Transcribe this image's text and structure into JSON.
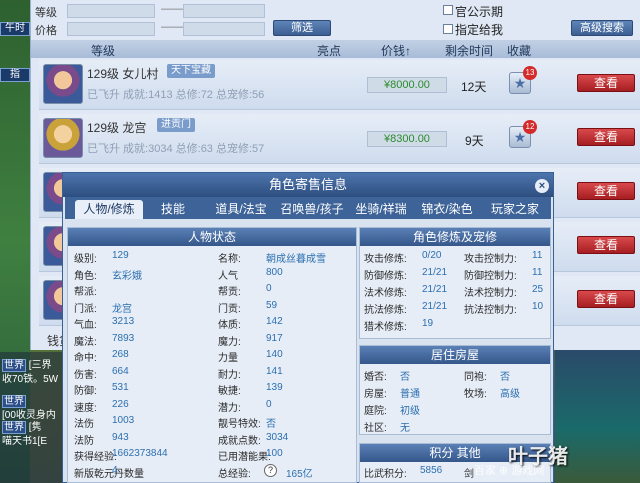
{
  "filters": {
    "row1_label": "等级",
    "row2_label": "价格",
    "dash": "——",
    "filter_button": "筛选",
    "public_period_label": "官公示期",
    "designated_label": "指定给我",
    "advanced_search": "高级搜索"
  },
  "columns": {
    "level": "等级",
    "highlight": "亮点",
    "price": "价钱↑",
    "remaining": "剩余时间",
    "favorite": "收藏"
  },
  "listings": [
    {
      "level": "129级",
      "school": "女儿村",
      "badge": "天下宝藏",
      "sub": "已飞升  成就:1413 总修:72 总宠修:56",
      "price": "¥8000.00",
      "remaining": "12天",
      "fav_count": "13",
      "view": "查看"
    },
    {
      "level": "129级",
      "school": "龙宫",
      "badge": "进贡门",
      "sub": "已飞升  成就:3034 总修:63 总宠修:57",
      "price": "¥8300.00",
      "remaining": "9天",
      "fav_count": "12",
      "view": "查看"
    },
    {
      "view": "查看"
    },
    {
      "view": "查看"
    },
    {
      "view": "查看"
    }
  ],
  "footer_label": "钱货",
  "chat": {
    "l1": "世界",
    "l1b": "[三界",
    "l2": "收70铁。5W",
    "l3": "世界",
    "l4": "[00收灵身内",
    "l5": "世界",
    "l5b": "[隽",
    "l6": "喵天书1[E"
  },
  "dialog": {
    "title": "角色寄售信息",
    "close": "×",
    "tabs": [
      "人物/修炼",
      "技能",
      "道具/法宝",
      "召唤兽/孩子",
      "坐骑/祥瑞",
      "锦衣/染色",
      "玩家之家"
    ],
    "status_title": "人物状态",
    "status_left": [
      {
        "k": "级别:",
        "v": "129"
      },
      {
        "k": "角色:",
        "v": "玄彩娥"
      },
      {
        "k": "帮派:",
        "v": ""
      },
      {
        "k": "门派:",
        "v": "龙宫"
      },
      {
        "k": "气血:",
        "v": "3213"
      },
      {
        "k": "魔法:",
        "v": "7893"
      },
      {
        "k": "命中:",
        "v": "268"
      },
      {
        "k": "伤害:",
        "v": "664"
      },
      {
        "k": "防御:",
        "v": "531"
      },
      {
        "k": "速度:",
        "v": "226"
      },
      {
        "k": "法伤",
        "v": "1003"
      },
      {
        "k": "法防",
        "v": "943"
      },
      {
        "k": "获得经验:",
        "v": "1662373844"
      },
      {
        "k": "新版乾元丹数量",
        "v": "4"
      }
    ],
    "status_right": [
      {
        "k": "名称:",
        "v": "朝成丝暮成雪"
      },
      {
        "k": "人气",
        "v": "800"
      },
      {
        "k": "帮贡:",
        "v": "0"
      },
      {
        "k": "门贡:",
        "v": "59"
      },
      {
        "k": "体质:",
        "v": "142"
      },
      {
        "k": "魔力:",
        "v": "917"
      },
      {
        "k": "力量",
        "v": "140"
      },
      {
        "k": "耐力:",
        "v": "141"
      },
      {
        "k": "敏捷:",
        "v": "139"
      },
      {
        "k": "潜力:",
        "v": "0"
      },
      {
        "k": "靓号特效:",
        "v": "否"
      },
      {
        "k": "成就点数:",
        "v": "3034"
      },
      {
        "k": "已用潜能果:",
        "v": "100"
      },
      {
        "k": "总经验:",
        "v": "165亿"
      }
    ],
    "cultivation_title": "角色修炼及宠修",
    "cultivation": [
      {
        "k": "攻击修炼:",
        "v": "0/20",
        "k2": "攻击控制力:",
        "v2": "11"
      },
      {
        "k": "防御修炼:",
        "v": "21/21",
        "k2": "防御控制力:",
        "v2": "11"
      },
      {
        "k": "法术修炼:",
        "v": "21/21",
        "k2": "法术控制力:",
        "v2": "25"
      },
      {
        "k": "抗法修炼:",
        "v": "21/21",
        "k2": "抗法控制力:",
        "v2": "10"
      },
      {
        "k": "猎术修炼:",
        "v": "19",
        "k2": "",
        "v2": ""
      }
    ],
    "house_title": "居住房屋",
    "house": [
      {
        "k": "婚否:",
        "v": "否",
        "k2": "同袍:",
        "v2": "否"
      },
      {
        "k": "房屋:",
        "v": "普通",
        "k2": "牧场:",
        "v2": "高级"
      },
      {
        "k": "庭院:",
        "v": "初级",
        "k2": "",
        "v2": ""
      },
      {
        "k": "社区:",
        "v": "无",
        "k2": "",
        "v2": ""
      }
    ],
    "points_title": "积分 其他",
    "points": [
      {
        "k": "比武积分:",
        "v": "5856",
        "k2": "剑",
        "v2": ""
      }
    ]
  },
  "watermark": "叶子猪",
  "watermark_sub": "百家 ⊕  游戏网"
}
